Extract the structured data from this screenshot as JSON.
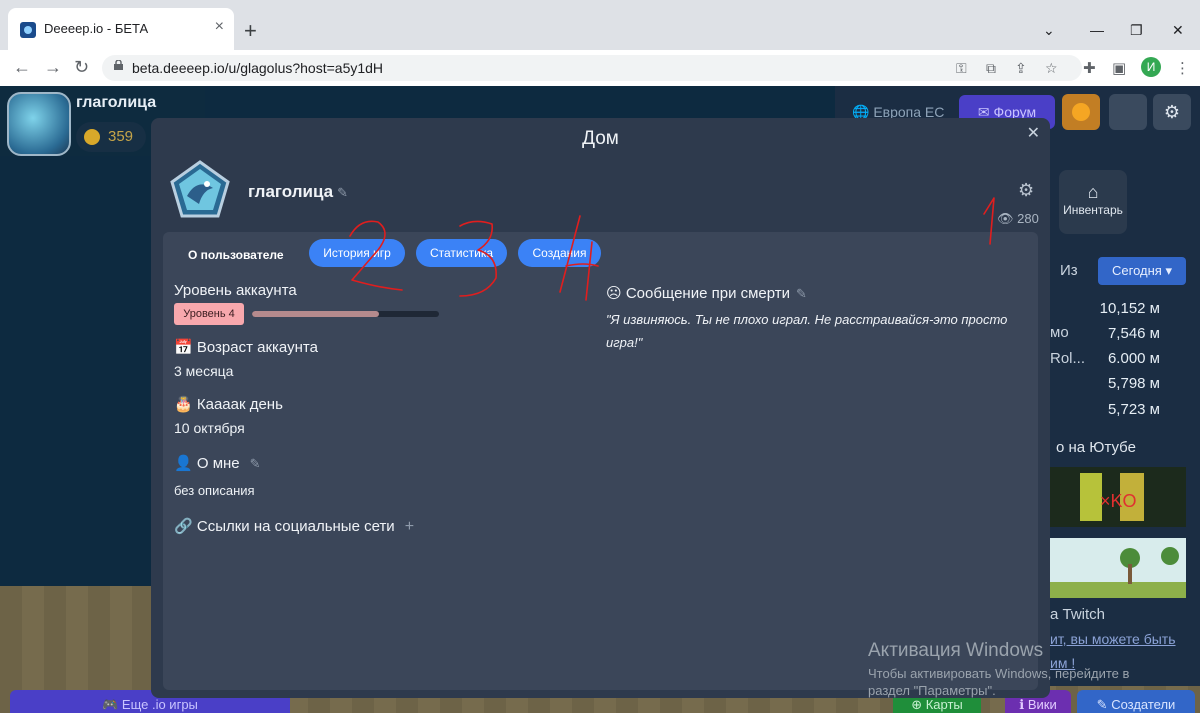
{
  "browser": {
    "tab_title": "Deeeep.io - БЕТА",
    "url": "beta.deeeep.io/u/glagolus?host=a5y1dH",
    "profile_initial": "И"
  },
  "game": {
    "username": "глаголица",
    "coins": "359",
    "region": "Европа ЕС",
    "forum_label": "Форум",
    "inventory_label": "Инвентарь",
    "leaderboard": {
      "from_label": "Из",
      "period": "Сегодня",
      "rows": [
        {
          "name": "",
          "score": "10,152 м"
        },
        {
          "name": "мо",
          "score": "7,546 м"
        },
        {
          "name": "Rol...",
          "score": "6.000 м"
        },
        {
          "name": "",
          "score": "5,798 м"
        },
        {
          "name": "",
          "score": "5,723 м"
        }
      ]
    },
    "youtube_title": "о на Ютубе",
    "twitch_title": "а Twitch",
    "twitch_link": "ит, вы можете быть",
    "twitch_link2": "им !",
    "bottom": {
      "more_games": "Еще .io игры",
      "maps": "Карты",
      "wiki": "Вики",
      "creators": "Создатели"
    }
  },
  "modal": {
    "title": "Дом",
    "username": "глаголица",
    "views": "280",
    "tabs": [
      "О пользователе",
      "История игр",
      "Статистика",
      "Создания"
    ],
    "account_level_label": "Уровень аккаунта",
    "level_badge": "Уровень 4",
    "level_progress": 0.68,
    "account_age_label": "Возраст аккаунта",
    "account_age_value": "3 месяца",
    "birthday_label": "Каааак день",
    "birthday_value": "10 октября",
    "about_label": "О мне",
    "about_value": "без описания",
    "social_label": "Ссылки на социальные сети",
    "death_message_label": "Сообщение при смерти",
    "death_message": "\"Я извиняюсь. Ты не плохо играл. Не расстраивайся-это просто игра!\""
  },
  "watermark": {
    "line1": "Активация Windows",
    "line2": "Чтобы активировать Windows, перейдите в",
    "line3": "раздел \"Параметры\"."
  },
  "annotations": [
    "1",
    "2",
    "3",
    "4"
  ],
  "colors": {
    "modal_bg": "#2e3a4d",
    "inner_bg": "#3b4659",
    "pill_blue": "#3b82f6",
    "annotation_red": "#e01e1e"
  }
}
